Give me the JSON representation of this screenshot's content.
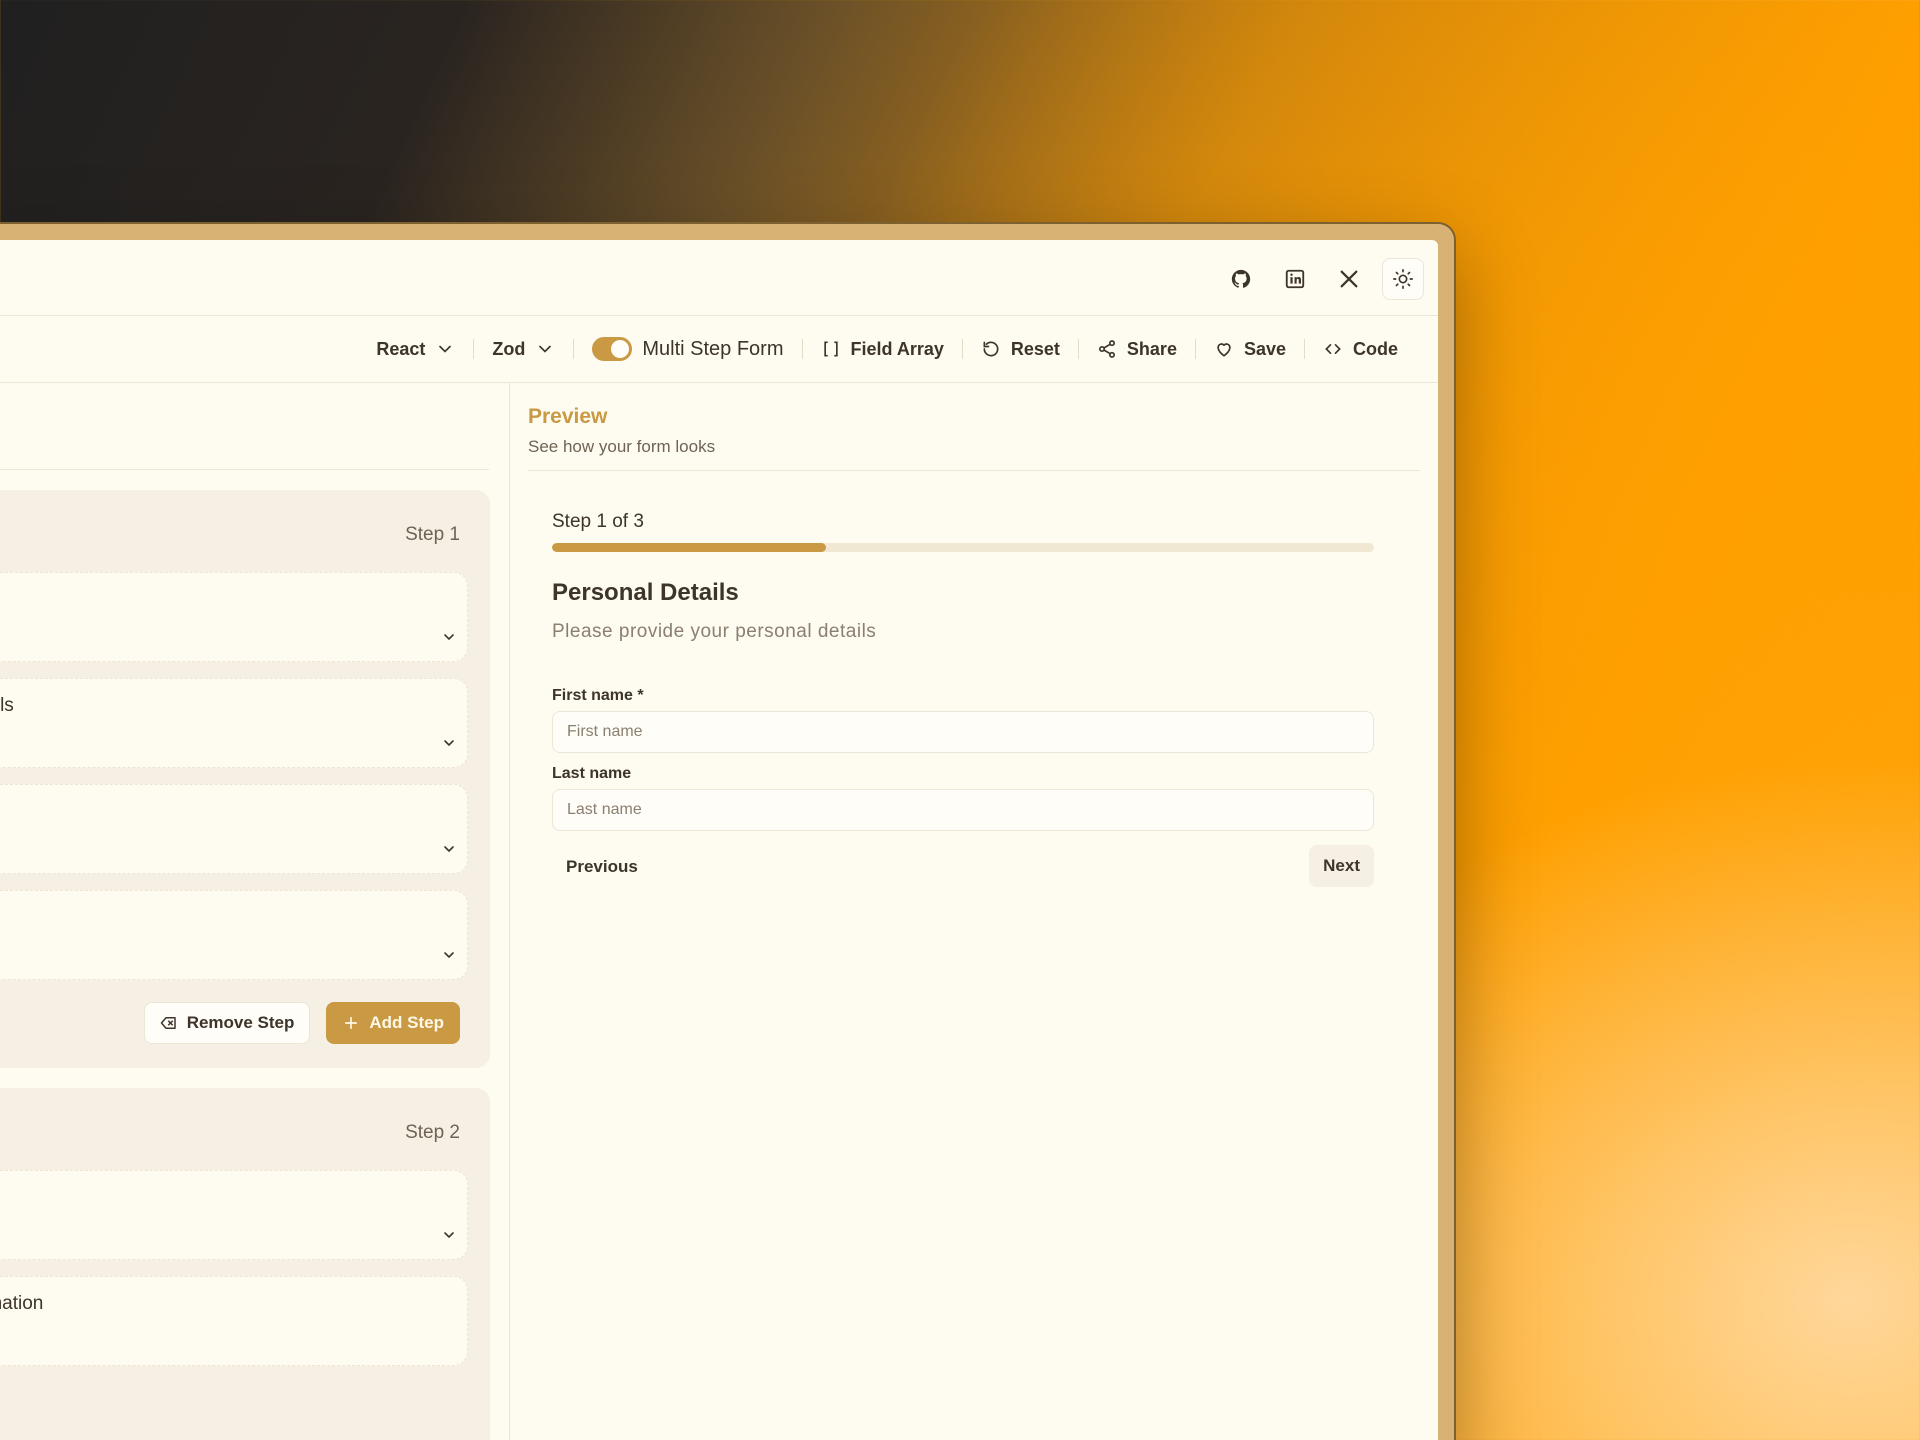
{
  "header": {
    "icons": [
      "github-icon",
      "linkedin-icon",
      "x-icon",
      "sun-icon"
    ]
  },
  "toolbar": {
    "framework": "React",
    "validation": "Zod",
    "multi_step_label": "Multi Step Form",
    "multi_step_enabled": true,
    "field_array": "Field Array",
    "reset": "Reset",
    "share": "Share",
    "save": "Save",
    "code": "Code"
  },
  "builder": {
    "steps": [
      {
        "label": "Step 1",
        "fields": [
          "",
          "tails",
          "",
          ""
        ],
        "remove_label": "Remove Step",
        "add_label": "Add Step"
      },
      {
        "label": "Step 2",
        "fields": [
          "",
          "rmation"
        ]
      }
    ]
  },
  "preview": {
    "title": "Preview",
    "subtitle": "See how your form looks",
    "step_counter": "Step 1 of 3",
    "progress_fraction": 0.333,
    "form_title": "Personal Details",
    "form_description": "Please provide your personal details",
    "fields": [
      {
        "label": "First name *",
        "placeholder": "First name"
      },
      {
        "label": "Last name",
        "placeholder": "Last name"
      }
    ],
    "previous": "Previous",
    "next": "Next"
  },
  "colors": {
    "accent": "#c99a43",
    "background": "#fefbf1"
  }
}
